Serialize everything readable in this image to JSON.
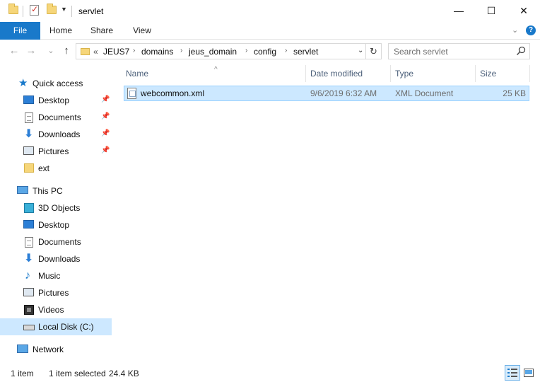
{
  "window": {
    "title": "servlet",
    "controls": {
      "minimize": "—",
      "maximize": "☐",
      "close": "✕"
    }
  },
  "ribbon": {
    "tabs": [
      "File",
      "Home",
      "Share",
      "View"
    ],
    "collapse": "⌄",
    "help": "?"
  },
  "navigation": {
    "back": "←",
    "forward": "→",
    "recent": "⌄",
    "up": "↑",
    "overflow": "«",
    "breadcrumb": [
      "JEUS7",
      "domains",
      "jeus_domain",
      "config",
      "servlet"
    ],
    "refresh": "↻",
    "search_placeholder": "Search servlet"
  },
  "sidebar": {
    "quick_access": {
      "label": "Quick access",
      "items": [
        {
          "label": "Desktop",
          "icon": "desktop-icon",
          "pinned": true
        },
        {
          "label": "Documents",
          "icon": "documents-icon",
          "pinned": true
        },
        {
          "label": "Downloads",
          "icon": "downloads-icon",
          "pinned": true
        },
        {
          "label": "Pictures",
          "icon": "pictures-icon",
          "pinned": true
        },
        {
          "label": "ext",
          "icon": "folder-icon",
          "pinned": false
        }
      ]
    },
    "this_pc": {
      "label": "This PC",
      "items": [
        {
          "label": "3D Objects",
          "icon": "3d-objects-icon"
        },
        {
          "label": "Desktop",
          "icon": "desktop-icon"
        },
        {
          "label": "Documents",
          "icon": "documents-icon"
        },
        {
          "label": "Downloads",
          "icon": "downloads-icon"
        },
        {
          "label": "Music",
          "icon": "music-icon"
        },
        {
          "label": "Pictures",
          "icon": "pictures-icon"
        },
        {
          "label": "Videos",
          "icon": "videos-icon"
        },
        {
          "label": "Local Disk (C:)",
          "icon": "local-disk-icon",
          "selected": true
        }
      ]
    },
    "network": {
      "label": "Network"
    },
    "pin_glyph": "📌"
  },
  "columns": [
    "Name",
    "Date modified",
    "Type",
    "Size"
  ],
  "sort_indicator": "^",
  "files": [
    {
      "name": "webcommon.xml",
      "date_modified": "9/6/2019 6:32 AM",
      "type": "XML Document",
      "size": "25 KB",
      "selected": true
    }
  ],
  "status": {
    "item_count": "1 item",
    "selection": "1 item selected",
    "selection_size": "24.4 KB"
  },
  "colors": {
    "accent": "#1979ca",
    "selection_bg": "#cce8ff",
    "selection_border": "#99d1ff"
  }
}
